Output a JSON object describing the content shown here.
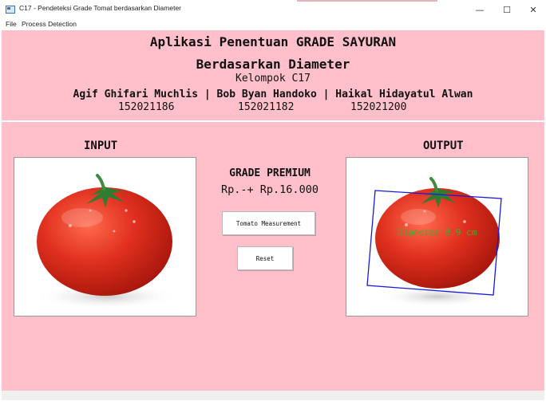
{
  "window": {
    "title": "C17 - Pendeteksi Grade Tomat berdasarkan Diameter",
    "minimize_icon": "minimize-icon",
    "maximize_icon": "maximize-icon",
    "close_icon": "close-icon",
    "min_glyph": "—",
    "max_glyph": "☐",
    "close_glyph": "✕"
  },
  "menu": {
    "items": [
      "File",
      "Process Detection"
    ]
  },
  "header": {
    "line1": "Aplikasi Penentuan GRADE SAYURAN",
    "line2": "Berdasarkan Diameter",
    "line3": "Kelompok C17",
    "line4": "Agif Ghifari Muchlis | Bob Byan Handoko | Haikal Hidayatul Alwan",
    "nims": [
      "152021186",
      "152021182",
      "152021200"
    ]
  },
  "main": {
    "input_label": "INPUT",
    "output_label": "OUTPUT",
    "grade_label": "GRADE PREMIUM",
    "price_label": "Rp.-+ Rp.16.000",
    "measure_button": "Tomato Measurement",
    "reset_button": "Reset",
    "diameter_annotation": "Diameter 8.9 cm"
  },
  "colors": {
    "background": "#ffc0cb",
    "tomato": "#d8261c",
    "leaf": "#2e7d32",
    "annotation_text": "#2fb52f",
    "bounding_box": "#1a1ad6"
  }
}
